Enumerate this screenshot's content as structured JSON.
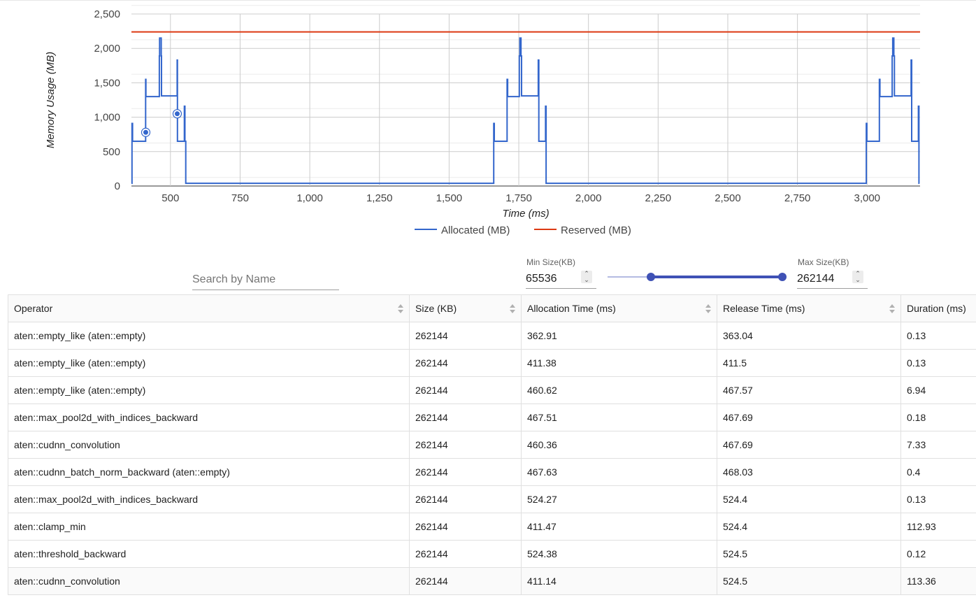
{
  "chart_data": {
    "type": "line",
    "xlabel": "Time (ms)",
    "ylabel": "Memory Usage (MB)",
    "xlim": [
      360,
      3190
    ],
    "ylim": [
      0,
      2500
    ],
    "x_ticks": [
      500,
      750,
      1000,
      1250,
      1500,
      1750,
      2000,
      2250,
      2500,
      2750,
      3000
    ],
    "x_tick_labels": [
      "500",
      "750",
      "1,000",
      "1,250",
      "1,500",
      "1,750",
      "2,000",
      "2,250",
      "2,500",
      "2,750",
      "3,000"
    ],
    "y_ticks": [
      0,
      500,
      1000,
      1500,
      2000,
      2500
    ],
    "y_tick_labels": [
      "0",
      "500",
      "1,000",
      "1,500",
      "2,000",
      "2,500"
    ],
    "grid": true,
    "legend_position": "bottom",
    "series": [
      {
        "name": "Allocated (MB)",
        "color": "#3366cc",
        "x": [
          360,
          362,
          362,
          364,
          364,
          366,
          366,
          411,
          411,
          412,
          412,
          414,
          414,
          460,
          460,
          461,
          461,
          467,
          467,
          468,
          468,
          469,
          469,
          524,
          524,
          525,
          525,
          527,
          527,
          550,
          550,
          552,
          552,
          555,
          555,
          1660,
          1660,
          1662,
          1662,
          1664,
          1664,
          1708,
          1708,
          1710,
          1710,
          1712,
          1712,
          1752,
          1752,
          1754,
          1754,
          1758,
          1758,
          1760,
          1760,
          1762,
          1762,
          1820,
          1820,
          1822,
          1822,
          1824,
          1824,
          1846,
          1846,
          1848,
          1848,
          1852,
          1852,
          2997,
          2997,
          2999,
          2999,
          3001,
          3001,
          3044,
          3044,
          3046,
          3046,
          3048,
          3048,
          3090,
          3090,
          3092,
          3092,
          3096,
          3096,
          3098,
          3098,
          3100,
          3100,
          3158,
          3158,
          3160,
          3160,
          3162,
          3162,
          3184,
          3184,
          3186,
          3186,
          3188
        ],
        "values": [
          40,
          40,
          910,
          910,
          650,
          650,
          650,
          650,
          1550,
          1550,
          1300,
          1300,
          1300,
          1300,
          1890,
          1890,
          2150,
          2150,
          1890,
          1890,
          1310,
          1310,
          1310,
          1310,
          1830,
          1830,
          650,
          650,
          650,
          650,
          1160,
          1160,
          650,
          650,
          40,
          40,
          910,
          910,
          650,
          650,
          650,
          650,
          1550,
          1550,
          1300,
          1300,
          1300,
          1300,
          1890,
          1890,
          2150,
          2150,
          1890,
          1890,
          1310,
          1310,
          1310,
          1310,
          1830,
          1830,
          650,
          650,
          650,
          650,
          1160,
          1160,
          40,
          40,
          40,
          40,
          910,
          910,
          650,
          650,
          650,
          650,
          1550,
          1550,
          1300,
          1300,
          1300,
          1300,
          1890,
          1890,
          2150,
          2150,
          1890,
          1890,
          1310,
          1310,
          1310,
          1310,
          1830,
          1830,
          650,
          650,
          650,
          650,
          1160,
          1160,
          40,
          40
        ]
      },
      {
        "name": "Reserved (MB)",
        "color": "#dc3912",
        "x": [
          360,
          3190
        ],
        "values": [
          2240,
          2240
        ]
      }
    ],
    "markers": [
      {
        "x": 411.38,
        "y": 780
      },
      {
        "x": 524.27,
        "y": 1050
      }
    ]
  },
  "filters": {
    "search_placeholder": "Search by Name",
    "min_label": "Min Size(KB)",
    "min_value": "65536",
    "max_label": "Max Size(KB)",
    "max_value": "262144",
    "spin_up": "⌃",
    "spin_down": "⌄"
  },
  "table": {
    "columns": [
      "Operator",
      "Size (KB)",
      "Allocation Time (ms)",
      "Release Time (ms)",
      "Duration (ms)"
    ],
    "rows": [
      [
        "aten::empty_like (aten::empty)",
        "262144",
        "362.91",
        "363.04",
        "0.13"
      ],
      [
        "aten::empty_like (aten::empty)",
        "262144",
        "411.38",
        "411.5",
        "0.13"
      ],
      [
        "aten::empty_like (aten::empty)",
        "262144",
        "460.62",
        "467.57",
        "6.94"
      ],
      [
        "aten::max_pool2d_with_indices_backward",
        "262144",
        "467.51",
        "467.69",
        "0.18"
      ],
      [
        "aten::cudnn_convolution",
        "262144",
        "460.36",
        "467.69",
        "7.33"
      ],
      [
        "aten::cudnn_batch_norm_backward (aten::empty)",
        "262144",
        "467.63",
        "468.03",
        "0.4"
      ],
      [
        "aten::max_pool2d_with_indices_backward",
        "262144",
        "524.27",
        "524.4",
        "0.13"
      ],
      [
        "aten::clamp_min",
        "262144",
        "411.47",
        "524.4",
        "112.93"
      ],
      [
        "aten::threshold_backward",
        "262144",
        "524.38",
        "524.5",
        "0.12"
      ],
      [
        "aten::cudnn_convolution",
        "262144",
        "411.14",
        "524.5",
        "113.36"
      ]
    ]
  }
}
